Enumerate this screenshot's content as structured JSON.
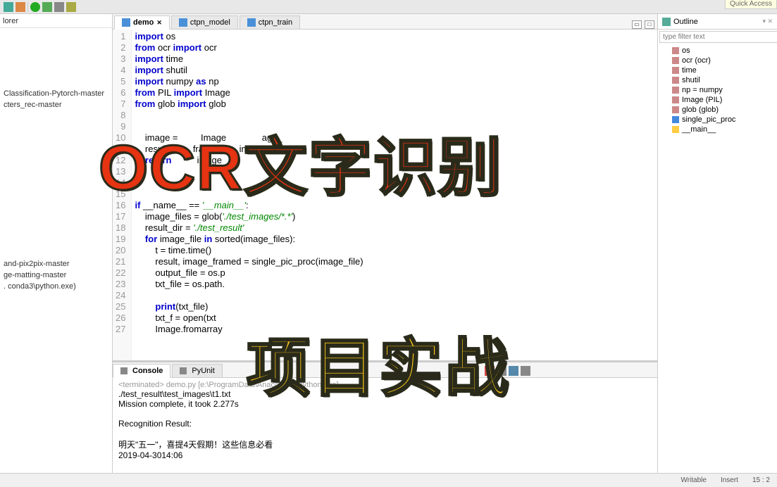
{
  "quickAccess": "Quick Access",
  "leftPanel": {
    "title": "lorer",
    "items": [
      "Classification-Pytorch-master",
      "cters_rec-master",
      "",
      "and-pix2pix-master",
      "ge-matting-master",
      ". conda3\\python.exe)"
    ]
  },
  "tabs": [
    {
      "label": "demo",
      "active": true
    },
    {
      "label": "ctpn_model",
      "active": false
    },
    {
      "label": "ctpn_train",
      "active": false
    }
  ],
  "code": {
    "lines": [
      {
        "n": 1,
        "html": "<span class='kw'>import</span> os"
      },
      {
        "n": 2,
        "html": "<span class='kw'>from</span> ocr <span class='kw'>import</span> ocr"
      },
      {
        "n": 3,
        "html": "<span class='kw'>import</span> time"
      },
      {
        "n": 4,
        "html": "<span class='kw'>import</span> shutil"
      },
      {
        "n": 5,
        "html": "<span class='kw'>import</span> numpy <span class='kw'>as</span> np"
      },
      {
        "n": 6,
        "html": "<span class='kw'>from</span> PIL <span class='kw'>import</span> Image"
      },
      {
        "n": 7,
        "html": "<span class='kw'>from</span> glob <span class='kw'>import</span> glob"
      },
      {
        "n": 8,
        "html": ""
      },
      {
        "n": 9,
        "html": ""
      },
      {
        "n": 10,
        "html": "    image =         Image              age_"
      },
      {
        "n": 11,
        "html": "    result          framed       image"
      },
      {
        "n": 12,
        "html": "    <span class='kw'>return</span>          image"
      },
      {
        "n": 13,
        "html": ""
      },
      {
        "n": 14,
        "html": ""
      },
      {
        "n": 15,
        "html": ""
      },
      {
        "n": 16,
        "html": "<span class='kw'>if</span> __name__ == <span class='str'>'__main__'</span>:"
      },
      {
        "n": 17,
        "html": "    image_files = glob(<span class='str'>'./test_images/*.*'</span>)"
      },
      {
        "n": 18,
        "html": "    result_dir = <span class='str'>'./test_result'</span>"
      },
      {
        "n": 19,
        "html": "    <span class='kw'>for</span> image_file <span class='kw'>in</span> sorted(image_files):"
      },
      {
        "n": 20,
        "html": "        t = time.time()"
      },
      {
        "n": 21,
        "html": "        result, image_framed = single_pic_proc(image_file)"
      },
      {
        "n": 22,
        "html": "        output_file = os.p"
      },
      {
        "n": 23,
        "html": "        txt_file = os.path."
      },
      {
        "n": 24,
        "html": ""
      },
      {
        "n": 25,
        "html": "        <span class='kw'>print</span>(txt_file)"
      },
      {
        "n": 26,
        "html": "        txt_f = open(txt"
      },
      {
        "n": 27,
        "html": "        Image.fromarray"
      }
    ]
  },
  "console": {
    "tabs": [
      {
        "label": "Console",
        "active": true
      },
      {
        "label": "PyUnit",
        "active": false
      }
    ],
    "terminated": "<terminated> demo.py [e:\\ProgramData\\Anaconda3\\python.exe]",
    "lines": [
      "./test_result\\test_images\\t1.txt",
      "Mission complete, it took 2.277s",
      "",
      "Recognition Result:",
      "",
      "明天\"五一\"，喜提4天假期！这些信息必看",
      "2019-04-3014:06"
    ]
  },
  "outline": {
    "title": "Outline",
    "filterPlaceholder": "type filter text",
    "items": [
      {
        "label": "os",
        "type": "import"
      },
      {
        "label": "ocr (ocr)",
        "type": "import"
      },
      {
        "label": "time",
        "type": "import"
      },
      {
        "label": "shutil",
        "type": "import"
      },
      {
        "label": "np = numpy",
        "type": "import"
      },
      {
        "label": "Image (PIL)",
        "type": "import"
      },
      {
        "label": "glob (glob)",
        "type": "import"
      },
      {
        "label": "single_pic_proc",
        "type": "func"
      },
      {
        "label": "__main__",
        "type": "main"
      }
    ]
  },
  "statusBar": {
    "writable": "Writable",
    "insert": "Insert",
    "pos": "15 : 2"
  },
  "overlay": {
    "text1": "OCR文字识别",
    "text2": "项目实战"
  }
}
